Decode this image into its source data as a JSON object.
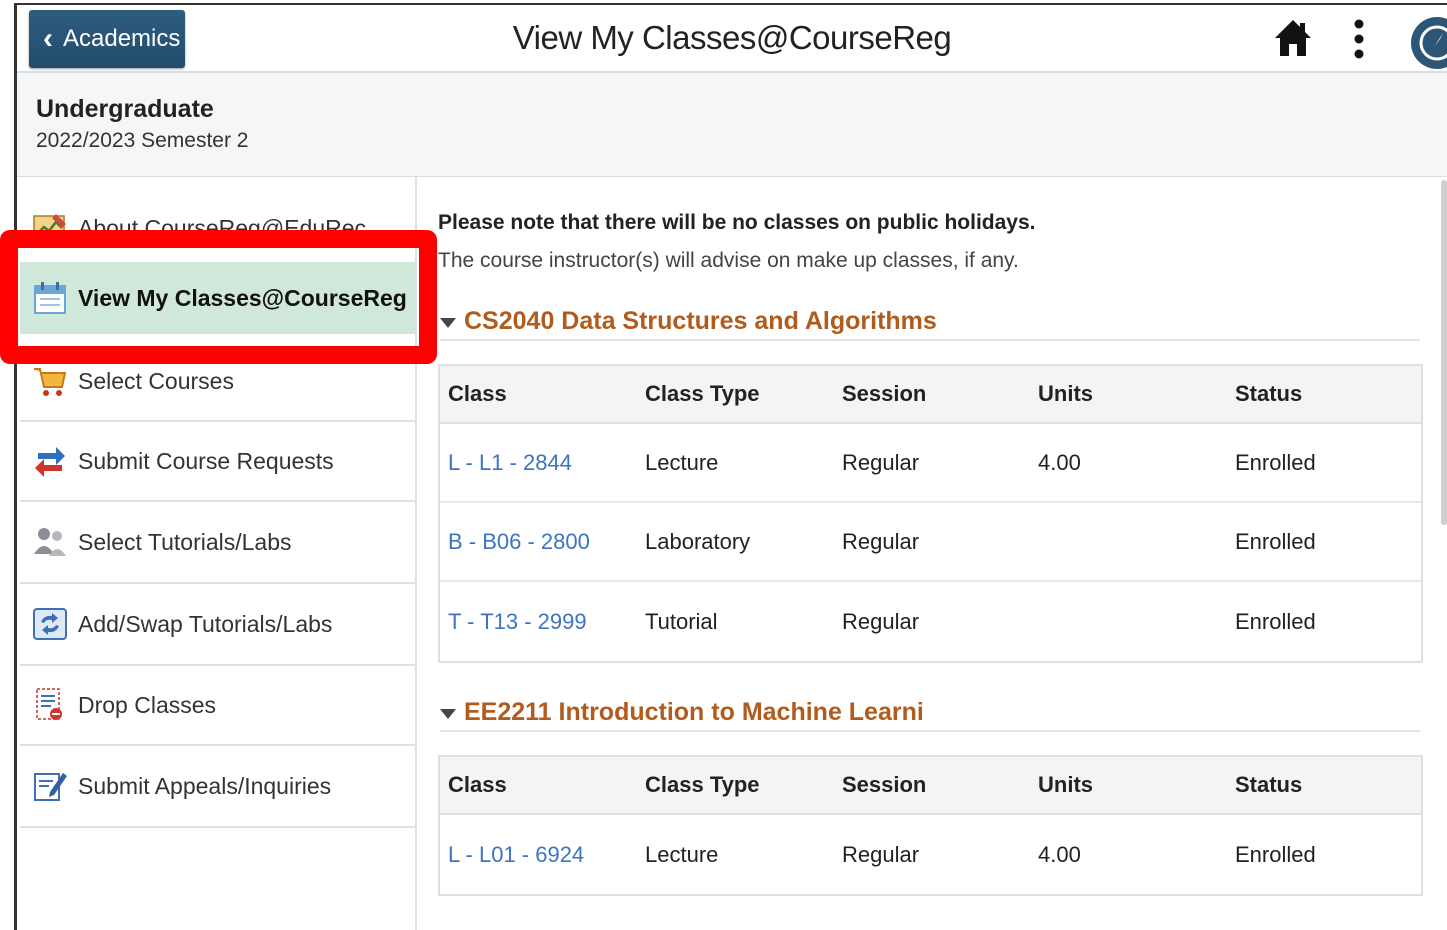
{
  "header": {
    "back_label": "Academics",
    "title": "View My Classes@CourseReg",
    "icons": [
      "home-icon",
      "more-options-icon",
      "navbar-icon"
    ]
  },
  "context": {
    "career": "Undergraduate",
    "term": "2022/2023 Semester 2"
  },
  "sidebar": {
    "items": [
      {
        "label": "About CourseReg@EduRec",
        "icon": "about-icon"
      },
      {
        "label": "View My Classes@CourseReg",
        "icon": "calendar-icon",
        "active": true
      },
      {
        "label": "Select Courses",
        "icon": "shopping-cart-icon"
      },
      {
        "label": "Submit Course Requests",
        "icon": "swap-arrows-icon"
      },
      {
        "label": "Select Tutorials/Labs",
        "icon": "people-icon"
      },
      {
        "label": "Add/Swap Tutorials/Labs",
        "icon": "refresh-icon"
      },
      {
        "label": "Drop Classes",
        "icon": "drop-document-icon"
      },
      {
        "label": "Submit Appeals/Inquiries",
        "icon": "edit-document-icon"
      }
    ]
  },
  "main": {
    "notice_bold": "Please note that there will be no classes on public holidays.",
    "notice": "The course instructor(s) will advise on make up classes, if any.",
    "columns": [
      "Class",
      "Class Type",
      "Session",
      "Units",
      "Status"
    ],
    "courses": [
      {
        "title": "CS2040 Data Structures and Algorithms",
        "rows": [
          [
            "L - L1 - 2844",
            "Lecture",
            "Regular",
            "4.00",
            "Enrolled"
          ],
          [
            "B - B06 - 2800",
            "Laboratory",
            "Regular",
            "",
            "Enrolled"
          ],
          [
            "T - T13 - 2999",
            "Tutorial",
            "Regular",
            "",
            "Enrolled"
          ]
        ]
      },
      {
        "title": "EE2211 Introduction to Machine Learni",
        "rows": [
          [
            "L - L01 - 6924",
            "Lecture",
            "Regular",
            "4.00",
            "Enrolled"
          ]
        ]
      }
    ]
  },
  "colors": {
    "accent_button": "#2b5676",
    "active_item": "#cfe8da",
    "section_title": "#b15c1e",
    "link": "#3c74c3",
    "highlight": "#ff0000"
  }
}
